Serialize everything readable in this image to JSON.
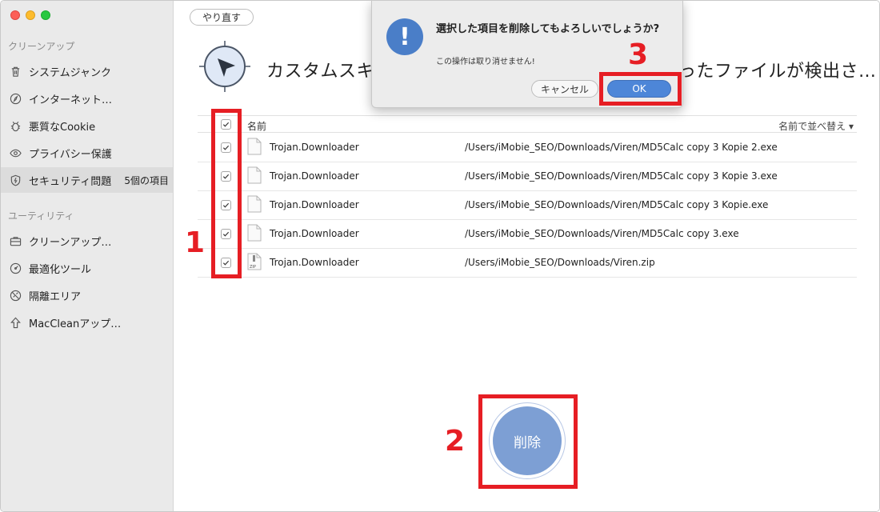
{
  "sidebar": {
    "cleanup_title": "クリーンアップ",
    "cleanup_items": [
      {
        "label": "システムジャンク",
        "icon": "trash-icon"
      },
      {
        "label": "インターネット…",
        "icon": "compass-icon"
      },
      {
        "label": "悪質なCookie",
        "icon": "bug-icon"
      },
      {
        "label": "プライバシー保護",
        "icon": "eye-icon"
      },
      {
        "label": "セキュリティ問題",
        "icon": "shield-icon",
        "count": "5個の項目"
      }
    ],
    "utility_title": "ユーティリティ",
    "utility_items": [
      {
        "label": "クリーンアップ…",
        "icon": "briefcase-icon"
      },
      {
        "label": "最適化ツール",
        "icon": "gauge-icon"
      },
      {
        "label": "隔離エリア",
        "icon": "shredder-icon"
      },
      {
        "label": "MacCleanアップ…",
        "icon": "upload-arrow-icon"
      }
    ]
  },
  "toolbar": {
    "redo_label": "やり直す"
  },
  "headline": {
    "left_text": "カスタムスキ",
    "right_text": "ったファイルが検出さ…"
  },
  "table": {
    "header_name": "名前",
    "sort_label": "名前で並べ替え ▾",
    "rows": [
      {
        "name": "Trojan.Downloader",
        "path": "/Users/iMobie_SEO/Downloads/Viren/MD5Calc copy 3 Kopie 2.exe",
        "checked": true,
        "icon": "file-icon"
      },
      {
        "name": "Trojan.Downloader",
        "path": "/Users/iMobie_SEO/Downloads/Viren/MD5Calc copy 3 Kopie 3.exe",
        "checked": true,
        "icon": "file-icon"
      },
      {
        "name": "Trojan.Downloader",
        "path": "/Users/iMobie_SEO/Downloads/Viren/MD5Calc copy 3 Kopie.exe",
        "checked": true,
        "icon": "file-icon"
      },
      {
        "name": "Trojan.Downloader",
        "path": "/Users/iMobie_SEO/Downloads/Viren/MD5Calc copy 3.exe",
        "checked": true,
        "icon": "file-icon"
      },
      {
        "name": "Trojan.Downloader",
        "path": "/Users/iMobie_SEO/Downloads/Viren.zip",
        "checked": true,
        "icon": "zip-file-icon"
      }
    ]
  },
  "delete_button": {
    "label": "削除"
  },
  "dialog": {
    "title": "選択した項目を削除してもよろしいでしょうか?",
    "message": "この操作は取り消せません!",
    "cancel_label": "キャンセル",
    "ok_label": "OK",
    "icon": "exclamation-icon"
  },
  "annotations": {
    "step1": "1",
    "step2": "2",
    "step3": "3",
    "color": "#e61e24"
  },
  "colors": {
    "accent": "#4d86d8",
    "delete_button": "#7d9fd4",
    "sidebar_bg": "#eaeaea"
  }
}
